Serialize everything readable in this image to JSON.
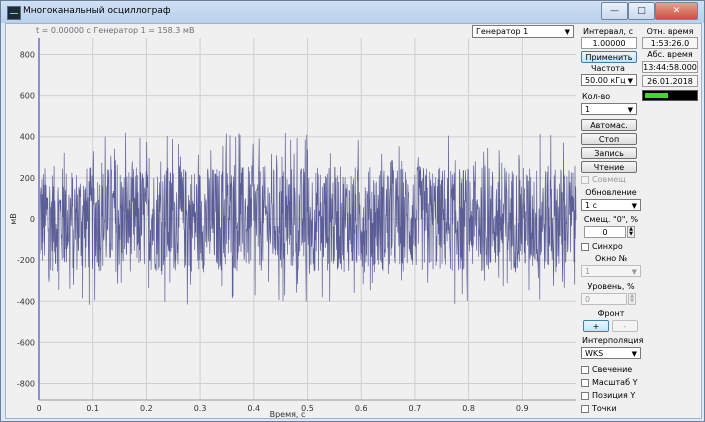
{
  "window": {
    "title": "Многоканальный осциллограф"
  },
  "status_text": "t = 0.00000 с  Генератор 1 = 158.3 мВ",
  "generator_select": {
    "value": "Генератор 1"
  },
  "controls": {
    "interval_label": "Интервал, с",
    "interval_value": "1.00000",
    "apply_label": "Применить",
    "frequency_label": "Частота",
    "frequency_value": "50.00 кГц",
    "channels_label": "Кол-во каналов",
    "channels_value": "1",
    "auto_label": "Автомас.",
    "stop_label": "Стоп",
    "record_label": "Запись",
    "read_label": "Чтение",
    "combine_label": "Совмещ",
    "update_label": "Обновление",
    "update_value": "1 с",
    "offset_label": "Смещ. \"0\", %",
    "offset_value": "0",
    "sync_label": "Синхро",
    "window_label": "Окно №",
    "window_value": "1",
    "level_label": "Уровень, %",
    "level_value": "0",
    "front_label": "Фронт",
    "front_plus": "+",
    "front_minus": "-",
    "interp_label": "Интерполяция",
    "interp_value": "WKS",
    "glow_label": "Свечение",
    "scale_y_label": "Масштаб Y",
    "position_y_label": "Позиция Y",
    "points_label": "Точки"
  },
  "time_panel": {
    "rel_label": "Отн. время",
    "rel_value": "1:53:26.0",
    "abs_label": "Абс. время",
    "abs_time": "13:44:58.000",
    "date": "26.01.2018",
    "level_fill": 0.45,
    "level_color": "#3fdc1e"
  },
  "chart_data": {
    "type": "line",
    "xlabel": "Время, с",
    "ylabel": "мВ",
    "xlim": [
      0,
      1.0
    ],
    "ylim": [
      -880,
      880
    ],
    "x_ticks": [
      "0",
      "0.1",
      "0.2",
      "0.3",
      "0.4",
      "0.5",
      "0.6",
      "0.7",
      "0.8",
      "0.9"
    ],
    "y_ticks": [
      "800",
      "600",
      "400",
      "200",
      "0",
      "-200",
      "-400",
      "-600",
      "-800"
    ],
    "series": [
      {
        "band_min": -260,
        "band_max": 260,
        "peak_min": -420,
        "peak_max": 420,
        "color": "#5b5e96"
      }
    ],
    "grid": true
  }
}
